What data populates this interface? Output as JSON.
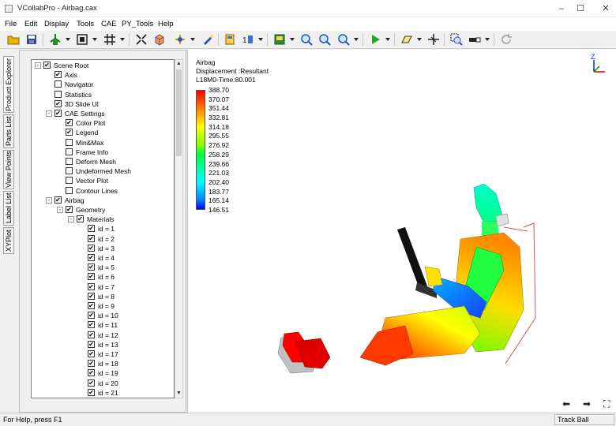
{
  "window": {
    "title": "VCollabPro - Airbag.cax",
    "minimize": "–",
    "maximize": "☐",
    "close": "✕"
  },
  "menu": [
    "File",
    "Edit",
    "Display",
    "Tools",
    "CAE",
    "PY_Tools",
    "Help"
  ],
  "toolbar": {
    "icons": [
      "open-folder-icon",
      "save-icon",
      "view-orient-icon",
      "fit-icon",
      "select-icon",
      "grid-icon",
      "cube-icon",
      "axis-move-icon",
      "paint-icon",
      "probe-icon",
      "number-icon",
      "image-icon",
      "zoom-in-icon",
      "zoom-out-icon",
      "zoom-window-icon",
      "play-icon",
      "shape-icon",
      "section-icon",
      "zoom-region-icon",
      "bar-icon",
      "refresh-icon"
    ]
  },
  "side_tabs": [
    "Product Explorer",
    "Parts List",
    "View Points",
    "Label List",
    "XYPlot"
  ],
  "tree": [
    {
      "label": "Scene Root",
      "checked": true,
      "expand": "-",
      "level": 0
    },
    {
      "label": "Axis",
      "checked": true,
      "level": 1
    },
    {
      "label": "Navigator",
      "checked": false,
      "level": 1
    },
    {
      "label": "Statistics",
      "checked": false,
      "level": 1
    },
    {
      "label": "3D Slide UI",
      "checked": true,
      "level": 1
    },
    {
      "label": "CAE Settings",
      "checked": true,
      "expand": "-",
      "level": 1
    },
    {
      "label": "Color Plot",
      "checked": true,
      "level": 2
    },
    {
      "label": "Legend",
      "checked": true,
      "level": 2
    },
    {
      "label": "Min&Max",
      "checked": false,
      "level": 2
    },
    {
      "label": "Frame Info",
      "checked": false,
      "level": 2
    },
    {
      "label": "Deform Mesh",
      "checked": false,
      "level": 2
    },
    {
      "label": "Undeformed Mesh",
      "checked": false,
      "level": 2
    },
    {
      "label": "Vector Plot",
      "checked": false,
      "level": 2
    },
    {
      "label": "Contour Lines",
      "checked": false,
      "level": 2
    },
    {
      "label": "Airbag",
      "checked": true,
      "expand": "-",
      "level": 1
    },
    {
      "label": "Geometry",
      "checked": true,
      "expand": "-",
      "level": 2
    },
    {
      "label": "Materials",
      "checked": true,
      "expand": "-",
      "level": 3
    },
    {
      "label": "id = 1",
      "checked": true,
      "level": 4
    },
    {
      "label": "id = 2",
      "checked": true,
      "level": 4
    },
    {
      "label": "id = 3",
      "checked": true,
      "level": 4
    },
    {
      "label": "id = 4",
      "checked": true,
      "level": 4
    },
    {
      "label": "id = 5",
      "checked": true,
      "level": 4
    },
    {
      "label": "id = 6",
      "checked": true,
      "level": 4
    },
    {
      "label": "id = 7",
      "checked": true,
      "level": 4
    },
    {
      "label": "id = 8",
      "checked": true,
      "level": 4
    },
    {
      "label": "id = 9",
      "checked": true,
      "level": 4
    },
    {
      "label": "id = 10",
      "checked": true,
      "level": 4
    },
    {
      "label": "id = 11",
      "checked": true,
      "level": 4
    },
    {
      "label": "id = 12",
      "checked": true,
      "level": 4
    },
    {
      "label": "id = 13",
      "checked": true,
      "level": 4
    },
    {
      "label": "id = 17",
      "checked": true,
      "level": 4
    },
    {
      "label": "id = 18",
      "checked": true,
      "level": 4
    },
    {
      "label": "id = 19",
      "checked": true,
      "level": 4
    },
    {
      "label": "id = 20",
      "checked": true,
      "level": 4
    },
    {
      "label": "id = 21",
      "checked": true,
      "level": 4
    }
  ],
  "viewport": {
    "name": "Airbag",
    "quantity": "Displacement :Resultant",
    "frame": "L18M0-Time:80.001",
    "legend_values": [
      "388.70",
      "370.07",
      "351.44",
      "332.81",
      "314.18",
      "295.55",
      "276.92",
      "258.29",
      "239.66",
      "221.03",
      "202.40",
      "183.77",
      "165.14",
      "146.51"
    ],
    "legend_colors": [
      "#ff0000",
      "#ff4000",
      "#ff8000",
      "#ffbf00",
      "#ffff00",
      "#bfff00",
      "#80ff00",
      "#00ff40",
      "#00ff80",
      "#00ffbf",
      "#00ffff",
      "#00bfff",
      "#0080ff",
      "#0000ff"
    ],
    "axis_label": "Z",
    "nav": [
      "⬅",
      "➡",
      "⛶"
    ]
  },
  "status": {
    "left": "For Help, press F1",
    "right": "Track Ball"
  }
}
